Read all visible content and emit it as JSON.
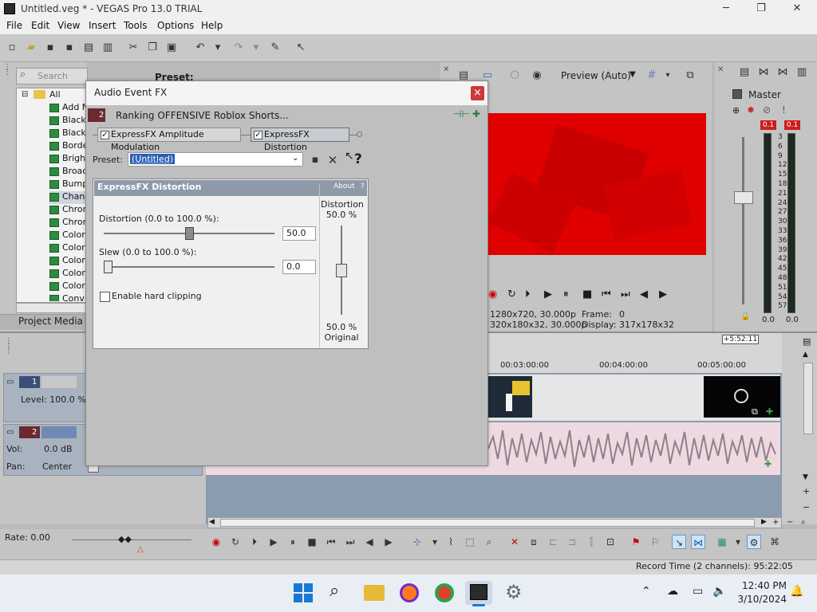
{
  "window": {
    "title": "Untitled.veg * - VEGAS Pro 13.0 TRIAL",
    "minimize": "─",
    "restore": "❐",
    "close": "✕"
  },
  "menu": [
    "File",
    "Edit",
    "View",
    "Insert",
    "Tools",
    "Options",
    "Help"
  ],
  "plugins": {
    "search_placeholder": "Search plug-ins",
    "preset_label": "Preset:",
    "root": "All",
    "items": [
      "Add N",
      "Black",
      "Black",
      "Borde",
      "Bright",
      "Broac",
      "Bump",
      "Chann",
      "Chror",
      "Chror",
      "Color",
      "Color",
      "Color",
      "Color",
      "Color",
      "Conv"
    ],
    "project_media_tab": "Project Media"
  },
  "dialog": {
    "title": "Audio Event FX",
    "close": "×",
    "event_number": "2",
    "event_name": "Ranking OFFENSIVE Roblox Shorts...",
    "tabs": [
      "ExpressFX Amplitude Modulation",
      "ExpressFX Distortion"
    ],
    "preset_label": "Preset:",
    "preset_value": "(Untitled)",
    "help": "?",
    "plugin_title": "ExpressFX Distortion",
    "about": "About",
    "about_q": "?",
    "distortion_label": "Distortion (0.0 to 100.0 %):",
    "distortion_value": "50.0",
    "distortion_level": 0.5,
    "slew_label": "Slew (0.0 to 100.0 %):",
    "slew_value": "0.0",
    "slew_level": 0.0,
    "enable_hard_clipping": "Enable hard clipping",
    "mix_title": "Distortion",
    "mix_top": "50.0 %",
    "mix_bottom_pct": "50.0 %",
    "mix_bottom_label": "Original"
  },
  "preview": {
    "mode": "Preview (Auto)",
    "project_info": "1280x720, 30.000p",
    "preview_info": "320x180x32, 30.000p",
    "frame_label": "Frame:",
    "frame_value": "0",
    "display_label": "Display:",
    "display_value": "317x178x32",
    "accent": "#e00000"
  },
  "master": {
    "title": "Master",
    "peak_left": "0.1",
    "peak_right": "0.1",
    "scale": [
      "3",
      "6",
      "9",
      "12",
      "15",
      "18",
      "21",
      "24",
      "27",
      "30",
      "33",
      "36",
      "39",
      "42",
      "45",
      "48",
      "51",
      "54",
      "57"
    ],
    "bottom_left": "0.0",
    "bottom_right": "0.0"
  },
  "timeline": {
    "end_marker": "+5:52:11",
    "ruler": [
      "00:03:00:00",
      "00:04:00:00",
      "00:05:00:00"
    ],
    "track1_number": "1",
    "track1_level": "Level: 100.0 %",
    "track2_number": "2",
    "track2_vol_label": "Vol:",
    "track2_vol_value": "0.0 dB",
    "track2_pan_label": "Pan:",
    "track2_pan_value": "Center",
    "rate": "Rate: 0.00",
    "record_time": "Record Time (2 channels): 95:22:05"
  },
  "taskbar": {
    "time": "12:40 PM",
    "date": "3/10/2024"
  }
}
